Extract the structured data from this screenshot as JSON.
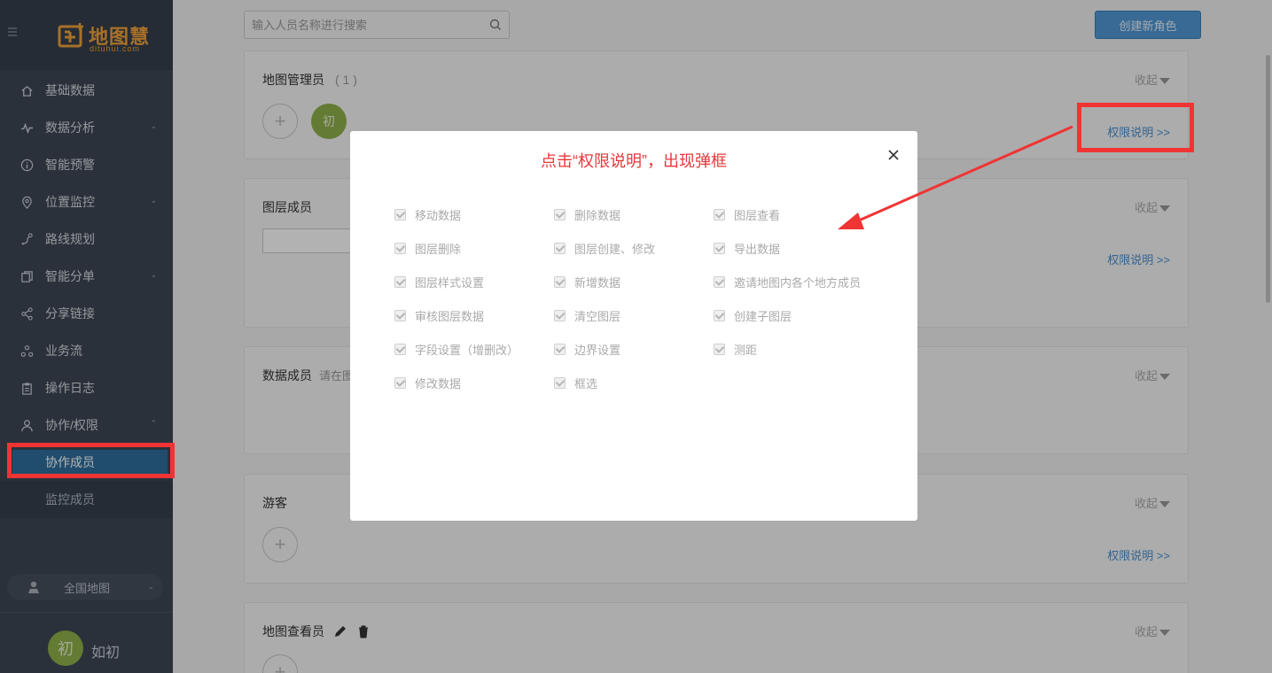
{
  "brand": {
    "name": "地图慧",
    "domain": "dituhui.com",
    "color": "#f0a33a"
  },
  "sidebar": {
    "items": [
      {
        "label": "基础数据",
        "icon": "home-icon",
        "has_children": false
      },
      {
        "label": "数据分析",
        "icon": "pulse-icon",
        "has_children": true
      },
      {
        "label": "智能预警",
        "icon": "info-icon",
        "has_children": false
      },
      {
        "label": "位置监控",
        "icon": "location-pin-icon",
        "has_children": true
      },
      {
        "label": "路线规划",
        "icon": "route-icon",
        "has_children": false
      },
      {
        "label": "智能分单",
        "icon": "copy-icon",
        "has_children": true
      },
      {
        "label": "分享链接",
        "icon": "share-icon",
        "has_children": false
      },
      {
        "label": "业务流",
        "icon": "workflow-icon",
        "has_children": false
      },
      {
        "label": "操作日志",
        "icon": "clipboard-icon",
        "has_children": false
      },
      {
        "label": "协作/权限",
        "icon": "user-icon",
        "has_children": true,
        "expanded": true
      }
    ],
    "sub_items": [
      {
        "label": "协作成员",
        "active": true
      },
      {
        "label": "监控成员",
        "active": false
      }
    ],
    "region": "全国地图",
    "user": {
      "avatar_text": "初",
      "name": "如初"
    }
  },
  "main": {
    "search_placeholder": "输入人员名称进行搜索",
    "create_button": "创建新角色",
    "collapse_label": "收起",
    "perm_link": "权限说明 >>",
    "cards": [
      {
        "title": "地图管理员",
        "count": "( 1 )",
        "member_avatar": "初"
      },
      {
        "title": "图层成员"
      },
      {
        "title": "数据成员",
        "hint": "请在图"
      },
      {
        "title": "游客"
      },
      {
        "title": "地图查看员"
      }
    ]
  },
  "modal": {
    "title": "点击“权限说明”，出现弹框",
    "permissions": [
      "移动数据",
      "删除数据",
      "图层查看",
      "图层删除",
      "图层创建、修改",
      "导出数据",
      "图层样式设置",
      "新增数据",
      "邀请地图内各个地方成员",
      "审核图层数据",
      "清空图层",
      "创建子图层",
      "字段设置（增删改）",
      "边界设置",
      "测距",
      "修改数据",
      "框选"
    ]
  },
  "colors": {
    "annotation_red": "#f03434",
    "sidebar_bg": "#3e4754",
    "active_blue": "#2f6f9e",
    "link_blue": "#4a8fcf"
  }
}
